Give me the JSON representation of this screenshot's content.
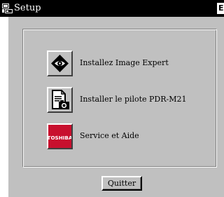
{
  "window": {
    "title": "Setup",
    "title_icon": "setup-computer-icon",
    "corner_button": "E"
  },
  "options": [
    {
      "label": "Installez Image Expert",
      "icon": "eye-diamond-icon"
    },
    {
      "label": "Installer le pilote PDR-M21",
      "icon": "document-camera-icon"
    },
    {
      "label": "Service et Aide",
      "icon": "toshiba-logo-icon",
      "icon_text": "TOSHIBA"
    }
  ],
  "quit_button": {
    "label": "Quitter"
  },
  "colors": {
    "titlebar": "#000000",
    "dialog_face": "#c0c0c0",
    "toshiba_red": "#c8102e"
  }
}
